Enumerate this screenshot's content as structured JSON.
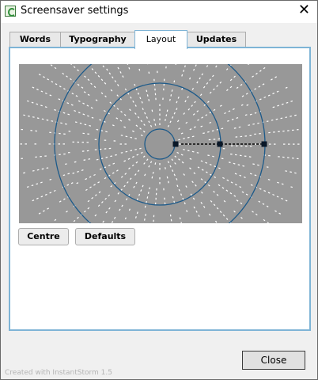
{
  "window": {
    "title": "Screensaver settings",
    "close_glyph": "✕"
  },
  "tabs": [
    {
      "label": "Words",
      "active": false
    },
    {
      "label": "Typography",
      "active": false
    },
    {
      "label": "Layout",
      "active": true
    },
    {
      "label": "Updates",
      "active": false
    }
  ],
  "layout": {
    "centre_label": "Centre",
    "defaults_label": "Defaults"
  },
  "dialog": {
    "close_label": "Close"
  },
  "footer": {
    "text": "Created with InstantStorm 1.5"
  },
  "colors": {
    "preview_bg": "#989898",
    "ring": "#1c5a8a",
    "active_tab_border": "#7eb4d6",
    "handle": "#0a1828"
  },
  "icons": {
    "app": "app-icon",
    "close": "close-icon"
  }
}
